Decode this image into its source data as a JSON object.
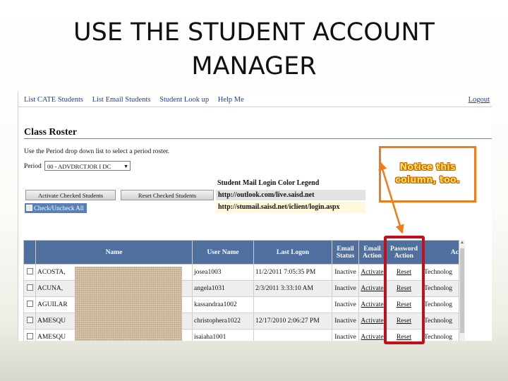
{
  "slide": {
    "title_line1": "USE THE STUDENT ACCOUNT",
    "title_line2": "MANAGER"
  },
  "nav": {
    "items": [
      "List CATE Students",
      "List Email Students",
      "Student Look up",
      "Help Me"
    ],
    "logout": "Logout"
  },
  "page": {
    "title": "Class Roster",
    "help": "Use the Period drop down list to select a period roster.",
    "period_label": "Period",
    "period_value": "00 - ADVDRCTJOR I DC"
  },
  "buttons": {
    "activate": "Activate Checked Students",
    "reset": "Reset Checked Students",
    "check_all": "Check/Uncheck All"
  },
  "legend": {
    "title": "Student Mail Login Color Legend",
    "url1": "http://outlook.com/live.saisd.net",
    "url2": "http://stumail.saisd.net/iclient/login.aspx",
    "colors": {
      "url1_bg": "#e2e2e2",
      "url2_bg": "#fff8dc"
    }
  },
  "table": {
    "headers": {
      "name": "Name",
      "user_name": "User Name",
      "last_logon": "Last Logon",
      "email_status_1": "Email",
      "email_status_2": "Status",
      "email_action_1": "Email",
      "email_action_2": "Action",
      "password_action_1": "Password",
      "password_action_2": "Action",
      "last_col": "Ac"
    },
    "rows": [
      {
        "name": "ACOSTA,",
        "user": "josea1003",
        "logon": "11/2/2011 7:05:35 PM",
        "status": "Inactive",
        "email_action": "Activate",
        "password_action": "Reset",
        "last": "Technolog"
      },
      {
        "name": "ACUNA,",
        "user": "angela1031",
        "logon": "2/3/2011 3:33:10 AM",
        "status": "Inactive",
        "email_action": "Activate",
        "password_action": "Reset",
        "last": "Technolog"
      },
      {
        "name": "AGUILAR",
        "user": "kassandraa1002",
        "logon": "",
        "status": "Inactive",
        "email_action": "Activate",
        "password_action": "Reset",
        "last": "Technolog"
      },
      {
        "name": "AMESQU",
        "user": "christopherа1022",
        "logon": "12/17/2010 2:06:27 PM",
        "status": "Inactive",
        "email_action": "Activate",
        "password_action": "Reset",
        "last": "Technolog"
      },
      {
        "name": "AMESQU",
        "user": "isaiaha1001",
        "logon": "",
        "status": "Inactive",
        "email_action": "Activate",
        "password_action": "Reset",
        "last": "Technolog"
      }
    ]
  },
  "callout": {
    "line1": "Notice this",
    "line2": "column, too."
  },
  "colors": {
    "header_blue": "#4f6f9f",
    "callout_orange": "#ef7c1a",
    "highlight_red": "#c0101c",
    "nav_link": "#1f3f9a"
  }
}
